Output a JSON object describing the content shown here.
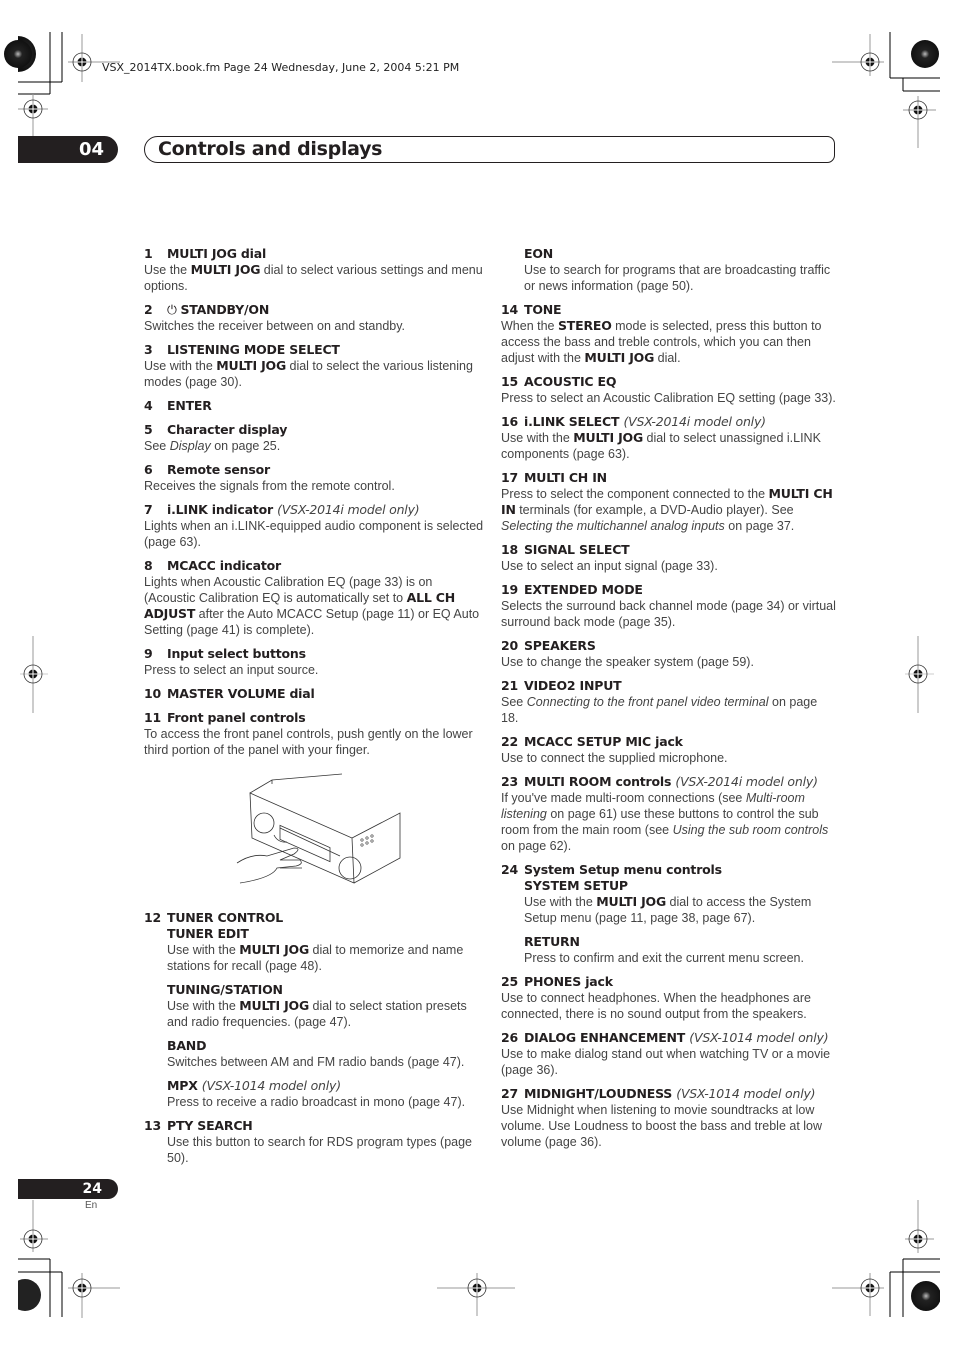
{
  "running_header": "VSX_2014TX.book.fm  Page 24  Wednesday, June 2, 2004  5:21 PM",
  "chapter": {
    "number": "04",
    "title": "Controls and displays"
  },
  "footer": {
    "page_number": "24",
    "language": "En"
  },
  "illustration": {
    "description": "Receiver front panel with hand pushing lower third of panel",
    "icon": "receiver-panel-illustration"
  },
  "left_column": [
    {
      "num": "1",
      "title": "MULTI JOG dial",
      "body": [
        [
          "Use the ",
          ""
        ],
        [
          "MULTI JOG",
          "b"
        ],
        [
          " dial to select various settings and menu options.",
          ""
        ]
      ]
    },
    {
      "num": "2",
      "icon": "power-icon",
      "title": "STANDBY/ON",
      "body": [
        [
          "Switches the receiver between on and standby.",
          ""
        ]
      ]
    },
    {
      "num": "3",
      "title": "LISTENING MODE SELECT",
      "body": [
        [
          "Use with the ",
          ""
        ],
        [
          "MULTI JOG",
          "b"
        ],
        [
          " dial to select the various listening modes (page 30).",
          ""
        ]
      ]
    },
    {
      "num": "4",
      "title": "ENTER",
      "body": []
    },
    {
      "num": "5",
      "title": "Character display",
      "body": [
        [
          "See ",
          ""
        ],
        [
          "Display",
          "i"
        ],
        [
          " on page 25.",
          ""
        ]
      ]
    },
    {
      "num": "6",
      "title": "Remote sensor",
      "body": [
        [
          "Receives the signals from the remote control.",
          ""
        ]
      ]
    },
    {
      "num": "7",
      "title": "i.LINK indicator",
      "note": "(VSX-2014i model only)",
      "body": [
        [
          "Lights when an i.LINK-equipped audio component is selected (page 63).",
          ""
        ]
      ]
    },
    {
      "num": "8",
      "title": "MCACC indicator",
      "body": [
        [
          "Lights when Acoustic Calibration EQ (page 33) is on (Acoustic Calibration EQ is automatically set to ",
          ""
        ],
        [
          "ALL CH ADJUST",
          "b"
        ],
        [
          " after the Auto MCACC Setup (page 11) or EQ Auto Setting (page 41) is complete).",
          ""
        ]
      ]
    },
    {
      "num": "9",
      "title": "Input select buttons",
      "body": [
        [
          "Press to select an input source.",
          ""
        ]
      ]
    },
    {
      "num": "10",
      "title": "MASTER VOLUME dial",
      "body": []
    },
    {
      "num": "11",
      "title": "Front panel controls",
      "body": [
        [
          "To access the front panel controls, push gently on the lower third portion of the panel with your finger.",
          ""
        ]
      ],
      "illustration": true
    },
    {
      "num": "12",
      "title": "TUNER CONTROL",
      "body": [],
      "subs": [
        {
          "title": "TUNER EDIT",
          "body": [
            [
              "Use with the ",
              ""
            ],
            [
              "MULTI JOG",
              "b"
            ],
            [
              " dial to memorize and name stations for recall (page 48).",
              ""
            ]
          ]
        },
        {
          "title": "TUNING/STATION",
          "body": [
            [
              "Use with the ",
              ""
            ],
            [
              "MULTI JOG",
              "b"
            ],
            [
              " dial to select station presets and radio frequencies. (page 47).",
              ""
            ]
          ]
        },
        {
          "title": "BAND",
          "body": [
            [
              "Switches between AM and FM radio bands (page 47).",
              ""
            ]
          ]
        },
        {
          "title": "MPX",
          "note": "(VSX-1014 model only)",
          "body": [
            [
              "Press to receive a radio broadcast in mono (page 47).",
              ""
            ]
          ]
        }
      ]
    },
    {
      "num": "13",
      "title": "PTY SEARCH",
      "body": [],
      "subs": [
        {
          "title": "",
          "body": [
            [
              "Use this button to search for RDS program types (page 50).",
              ""
            ]
          ]
        }
      ]
    }
  ],
  "right_column": [
    {
      "num": "",
      "title": "",
      "body": [],
      "subs": [
        {
          "title": "EON",
          "body": [
            [
              "Use to search for programs that are broadcasting traffic or news information (page 50).",
              ""
            ]
          ]
        }
      ]
    },
    {
      "num": "14",
      "title": "TONE",
      "body": [
        [
          "When the ",
          ""
        ],
        [
          "STEREO",
          "b"
        ],
        [
          " mode is selected, press this button to access the bass and treble controls, which you can then adjust with the ",
          ""
        ],
        [
          "MULTI JOG",
          "b"
        ],
        [
          " dial.",
          ""
        ]
      ]
    },
    {
      "num": "15",
      "title": "ACOUSTIC EQ",
      "body": [
        [
          "Press to select an Acoustic Calibration EQ setting (page 33).",
          ""
        ]
      ]
    },
    {
      "num": "16",
      "title": "i.LINK SELECT",
      "note": "(VSX-2014i model only)",
      "body": [
        [
          "Use with the ",
          ""
        ],
        [
          "MULTI JOG",
          "b"
        ],
        [
          " dial to select unassigned i.LINK components (page 63).",
          ""
        ]
      ]
    },
    {
      "num": "17",
      "title": "MULTI CH IN",
      "body": [
        [
          "Press to select the component connected to the ",
          ""
        ],
        [
          "MULTI CH IN",
          "b"
        ],
        [
          " terminals (for example, a DVD-Audio player). See ",
          ""
        ],
        [
          "Selecting the multichannel analog inputs",
          "i"
        ],
        [
          " on page 37.",
          ""
        ]
      ]
    },
    {
      "num": "18",
      "title": "SIGNAL SELECT",
      "body": [
        [
          "Use to select an input signal (page 33).",
          ""
        ]
      ]
    },
    {
      "num": "19",
      "title": "EXTENDED MODE",
      "body": [
        [
          "Selects the surround back channel mode (page 34) or virtual surround back mode (page 35).",
          ""
        ]
      ]
    },
    {
      "num": "20",
      "title": "SPEAKERS",
      "body": [
        [
          "Use to change the speaker system (page 59).",
          ""
        ]
      ]
    },
    {
      "num": "21",
      "title": "VIDEO2 INPUT",
      "body": [
        [
          "See ",
          ""
        ],
        [
          "Connecting to the front panel video terminal",
          "i"
        ],
        [
          " on page 18.",
          ""
        ]
      ]
    },
    {
      "num": "22",
      "title": "MCACC SETUP MIC jack",
      "body": [
        [
          "Use to connect the supplied microphone.",
          ""
        ]
      ]
    },
    {
      "num": "23",
      "title": "MULTI ROOM controls",
      "note": "(VSX-2014i model only)",
      "body": [
        [
          "If you've made multi-room connections (see ",
          ""
        ],
        [
          "Multi-room listening",
          "i"
        ],
        [
          " on page 61) use these buttons to control the sub room from the main room (see ",
          ""
        ],
        [
          "Using the sub room controls",
          "i"
        ],
        [
          " on page 62).",
          ""
        ]
      ]
    },
    {
      "num": "24",
      "title": "System Setup menu controls",
      "body": [],
      "subs": [
        {
          "title": "SYSTEM SETUP",
          "body": [
            [
              "Use with the ",
              ""
            ],
            [
              "MULTI JOG",
              "b"
            ],
            [
              " dial to access the System Setup menu (page 11, page 38, page 67).",
              ""
            ]
          ]
        },
        {
          "title": "RETURN",
          "body": [
            [
              "Press to confirm and exit the current menu screen.",
              ""
            ]
          ]
        }
      ]
    },
    {
      "num": "25",
      "title": "PHONES jack",
      "body": [
        [
          "Use to connect headphones. When the headphones are connected, there is no sound output from the speakers.",
          ""
        ]
      ]
    },
    {
      "num": "26",
      "title": "DIALOG ENHANCEMENT",
      "note": "(VSX-1014 model only)",
      "body": [
        [
          "Use to make dialog stand out when watching TV or a movie (page 36).",
          ""
        ]
      ]
    },
    {
      "num": "27",
      "title": "MIDNIGHT/LOUDNESS",
      "note": "(VSX-1014 model only)",
      "body": [
        [
          "Use Midnight when listening to movie soundtracks at low volume. Use Loudness to boost the bass and treble at low volume (page 36).",
          ""
        ]
      ]
    }
  ]
}
